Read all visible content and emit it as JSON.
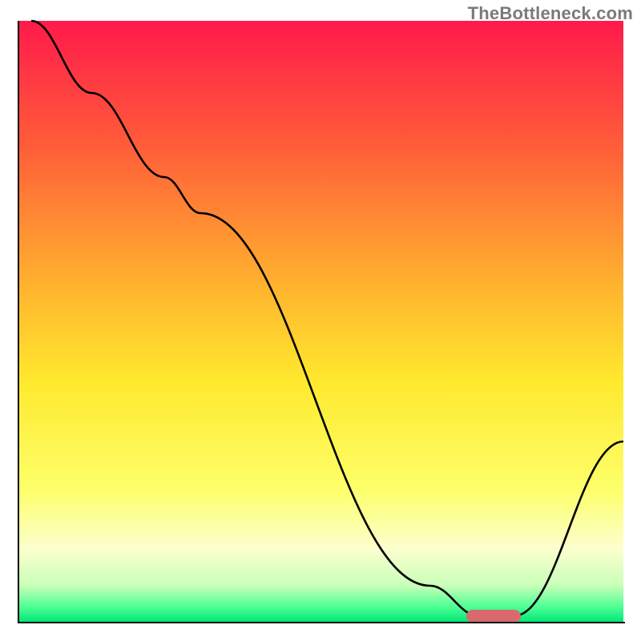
{
  "watermark": "TheBottleneck.com",
  "chart_data": {
    "type": "line",
    "title": "",
    "xlabel": "",
    "ylabel": "",
    "xlim": [
      0,
      100
    ],
    "ylim": [
      0,
      100
    ],
    "background_gradient": {
      "stops": [
        {
          "pos": 0.0,
          "color": "#ff1a4a"
        },
        {
          "pos": 0.2,
          "color": "#ff5a3a"
        },
        {
          "pos": 0.45,
          "color": "#ffb62e"
        },
        {
          "pos": 0.6,
          "color": "#ffe92e"
        },
        {
          "pos": 0.78,
          "color": "#fdff6a"
        },
        {
          "pos": 0.88,
          "color": "#fcffce"
        },
        {
          "pos": 0.94,
          "color": "#c8ffb8"
        },
        {
          "pos": 0.975,
          "color": "#4fff95"
        },
        {
          "pos": 1.0,
          "color": "#00e876"
        }
      ]
    },
    "series": [
      {
        "name": "bottleneck-curve",
        "x": [
          2,
          12,
          24,
          30,
          68,
          76,
          82,
          100
        ],
        "y": [
          100,
          88,
          74,
          68,
          6,
          1,
          1,
          30
        ]
      }
    ],
    "marker": {
      "name": "optimal-range",
      "x_start": 74,
      "x_end": 83,
      "y": 1,
      "color": "#d86a6f"
    }
  }
}
